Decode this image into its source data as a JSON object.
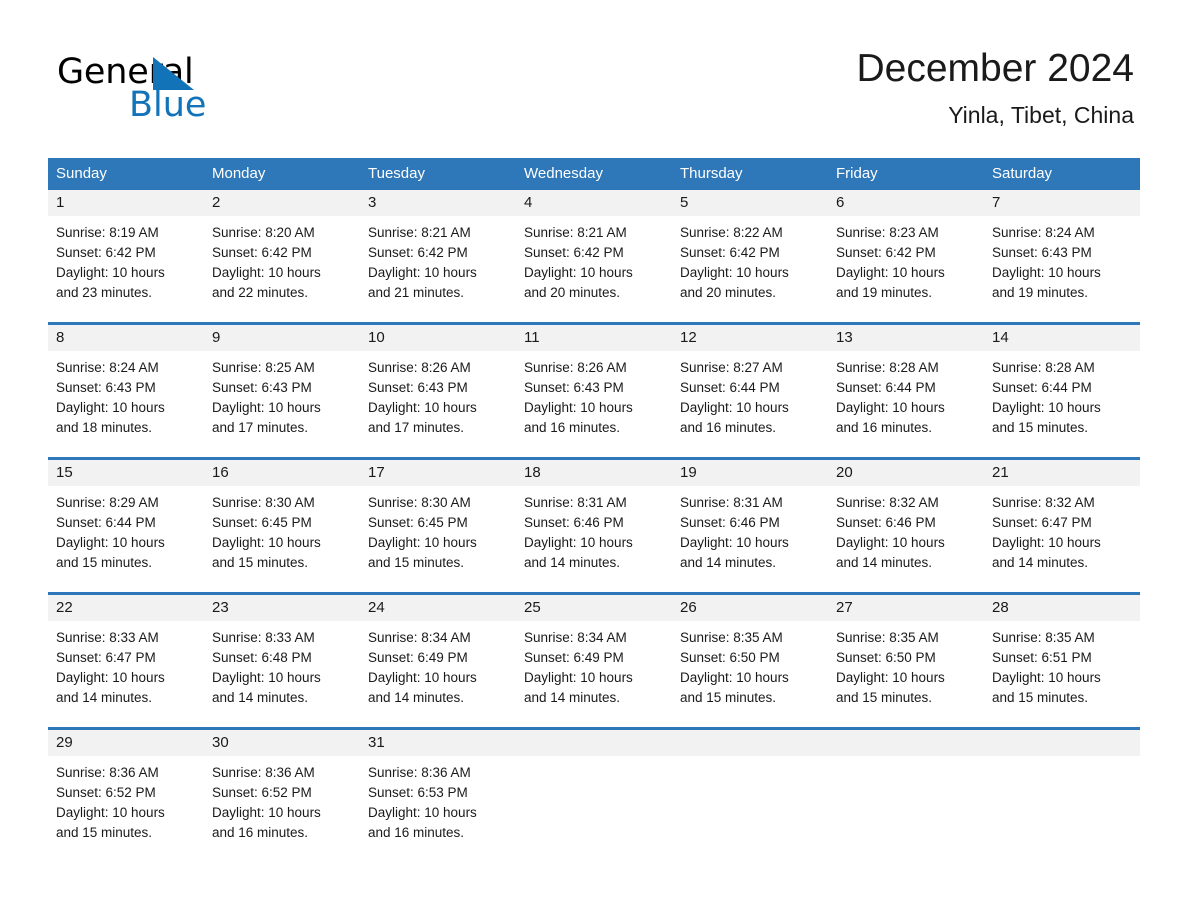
{
  "brand": {
    "name_part1": "General",
    "name_part2": "Blue",
    "triangle_color": "#1273b8"
  },
  "header": {
    "title": "December 2024",
    "subtitle": "Yinla, Tibet, China",
    "accent_color": "#2e77b8"
  },
  "weekday_headers": [
    "Sunday",
    "Monday",
    "Tuesday",
    "Wednesday",
    "Thursday",
    "Friday",
    "Saturday"
  ],
  "labels": {
    "sunrise_prefix": "Sunrise:",
    "sunset_prefix": "Sunset:",
    "daylight_prefix": "Daylight:"
  },
  "weeks": [
    [
      {
        "day": "1",
        "sunrise": "Sunrise: 8:19 AM",
        "sunset": "Sunset: 6:42 PM",
        "daylight_l1": "Daylight: 10 hours",
        "daylight_l2": "and 23 minutes."
      },
      {
        "day": "2",
        "sunrise": "Sunrise: 8:20 AM",
        "sunset": "Sunset: 6:42 PM",
        "daylight_l1": "Daylight: 10 hours",
        "daylight_l2": "and 22 minutes."
      },
      {
        "day": "3",
        "sunrise": "Sunrise: 8:21 AM",
        "sunset": "Sunset: 6:42 PM",
        "daylight_l1": "Daylight: 10 hours",
        "daylight_l2": "and 21 minutes."
      },
      {
        "day": "4",
        "sunrise": "Sunrise: 8:21 AM",
        "sunset": "Sunset: 6:42 PM",
        "daylight_l1": "Daylight: 10 hours",
        "daylight_l2": "and 20 minutes."
      },
      {
        "day": "5",
        "sunrise": "Sunrise: 8:22 AM",
        "sunset": "Sunset: 6:42 PM",
        "daylight_l1": "Daylight: 10 hours",
        "daylight_l2": "and 20 minutes."
      },
      {
        "day": "6",
        "sunrise": "Sunrise: 8:23 AM",
        "sunset": "Sunset: 6:42 PM",
        "daylight_l1": "Daylight: 10 hours",
        "daylight_l2": "and 19 minutes."
      },
      {
        "day": "7",
        "sunrise": "Sunrise: 8:24 AM",
        "sunset": "Sunset: 6:43 PM",
        "daylight_l1": "Daylight: 10 hours",
        "daylight_l2": "and 19 minutes."
      }
    ],
    [
      {
        "day": "8",
        "sunrise": "Sunrise: 8:24 AM",
        "sunset": "Sunset: 6:43 PM",
        "daylight_l1": "Daylight: 10 hours",
        "daylight_l2": "and 18 minutes."
      },
      {
        "day": "9",
        "sunrise": "Sunrise: 8:25 AM",
        "sunset": "Sunset: 6:43 PM",
        "daylight_l1": "Daylight: 10 hours",
        "daylight_l2": "and 17 minutes."
      },
      {
        "day": "10",
        "sunrise": "Sunrise: 8:26 AM",
        "sunset": "Sunset: 6:43 PM",
        "daylight_l1": "Daylight: 10 hours",
        "daylight_l2": "and 17 minutes."
      },
      {
        "day": "11",
        "sunrise": "Sunrise: 8:26 AM",
        "sunset": "Sunset: 6:43 PM",
        "daylight_l1": "Daylight: 10 hours",
        "daylight_l2": "and 16 minutes."
      },
      {
        "day": "12",
        "sunrise": "Sunrise: 8:27 AM",
        "sunset": "Sunset: 6:44 PM",
        "daylight_l1": "Daylight: 10 hours",
        "daylight_l2": "and 16 minutes."
      },
      {
        "day": "13",
        "sunrise": "Sunrise: 8:28 AM",
        "sunset": "Sunset: 6:44 PM",
        "daylight_l1": "Daylight: 10 hours",
        "daylight_l2": "and 16 minutes."
      },
      {
        "day": "14",
        "sunrise": "Sunrise: 8:28 AM",
        "sunset": "Sunset: 6:44 PM",
        "daylight_l1": "Daylight: 10 hours",
        "daylight_l2": "and 15 minutes."
      }
    ],
    [
      {
        "day": "15",
        "sunrise": "Sunrise: 8:29 AM",
        "sunset": "Sunset: 6:44 PM",
        "daylight_l1": "Daylight: 10 hours",
        "daylight_l2": "and 15 minutes."
      },
      {
        "day": "16",
        "sunrise": "Sunrise: 8:30 AM",
        "sunset": "Sunset: 6:45 PM",
        "daylight_l1": "Daylight: 10 hours",
        "daylight_l2": "and 15 minutes."
      },
      {
        "day": "17",
        "sunrise": "Sunrise: 8:30 AM",
        "sunset": "Sunset: 6:45 PM",
        "daylight_l1": "Daylight: 10 hours",
        "daylight_l2": "and 15 minutes."
      },
      {
        "day": "18",
        "sunrise": "Sunrise: 8:31 AM",
        "sunset": "Sunset: 6:46 PM",
        "daylight_l1": "Daylight: 10 hours",
        "daylight_l2": "and 14 minutes."
      },
      {
        "day": "19",
        "sunrise": "Sunrise: 8:31 AM",
        "sunset": "Sunset: 6:46 PM",
        "daylight_l1": "Daylight: 10 hours",
        "daylight_l2": "and 14 minutes."
      },
      {
        "day": "20",
        "sunrise": "Sunrise: 8:32 AM",
        "sunset": "Sunset: 6:46 PM",
        "daylight_l1": "Daylight: 10 hours",
        "daylight_l2": "and 14 minutes."
      },
      {
        "day": "21",
        "sunrise": "Sunrise: 8:32 AM",
        "sunset": "Sunset: 6:47 PM",
        "daylight_l1": "Daylight: 10 hours",
        "daylight_l2": "and 14 minutes."
      }
    ],
    [
      {
        "day": "22",
        "sunrise": "Sunrise: 8:33 AM",
        "sunset": "Sunset: 6:47 PM",
        "daylight_l1": "Daylight: 10 hours",
        "daylight_l2": "and 14 minutes."
      },
      {
        "day": "23",
        "sunrise": "Sunrise: 8:33 AM",
        "sunset": "Sunset: 6:48 PM",
        "daylight_l1": "Daylight: 10 hours",
        "daylight_l2": "and 14 minutes."
      },
      {
        "day": "24",
        "sunrise": "Sunrise: 8:34 AM",
        "sunset": "Sunset: 6:49 PM",
        "daylight_l1": "Daylight: 10 hours",
        "daylight_l2": "and 14 minutes."
      },
      {
        "day": "25",
        "sunrise": "Sunrise: 8:34 AM",
        "sunset": "Sunset: 6:49 PM",
        "daylight_l1": "Daylight: 10 hours",
        "daylight_l2": "and 14 minutes."
      },
      {
        "day": "26",
        "sunrise": "Sunrise: 8:35 AM",
        "sunset": "Sunset: 6:50 PM",
        "daylight_l1": "Daylight: 10 hours",
        "daylight_l2": "and 15 minutes."
      },
      {
        "day": "27",
        "sunrise": "Sunrise: 8:35 AM",
        "sunset": "Sunset: 6:50 PM",
        "daylight_l1": "Daylight: 10 hours",
        "daylight_l2": "and 15 minutes."
      },
      {
        "day": "28",
        "sunrise": "Sunrise: 8:35 AM",
        "sunset": "Sunset: 6:51 PM",
        "daylight_l1": "Daylight: 10 hours",
        "daylight_l2": "and 15 minutes."
      }
    ],
    [
      {
        "day": "29",
        "sunrise": "Sunrise: 8:36 AM",
        "sunset": "Sunset: 6:52 PM",
        "daylight_l1": "Daylight: 10 hours",
        "daylight_l2": "and 15 minutes."
      },
      {
        "day": "30",
        "sunrise": "Sunrise: 8:36 AM",
        "sunset": "Sunset: 6:52 PM",
        "daylight_l1": "Daylight: 10 hours",
        "daylight_l2": "and 16 minutes."
      },
      {
        "day": "31",
        "sunrise": "Sunrise: 8:36 AM",
        "sunset": "Sunset: 6:53 PM",
        "daylight_l1": "Daylight: 10 hours",
        "daylight_l2": "and 16 minutes."
      },
      {
        "day": "",
        "sunrise": "",
        "sunset": "",
        "daylight_l1": "",
        "daylight_l2": ""
      },
      {
        "day": "",
        "sunrise": "",
        "sunset": "",
        "daylight_l1": "",
        "daylight_l2": ""
      },
      {
        "day": "",
        "sunrise": "",
        "sunset": "",
        "daylight_l1": "",
        "daylight_l2": ""
      },
      {
        "day": "",
        "sunrise": "",
        "sunset": "",
        "daylight_l1": "",
        "daylight_l2": ""
      }
    ]
  ]
}
